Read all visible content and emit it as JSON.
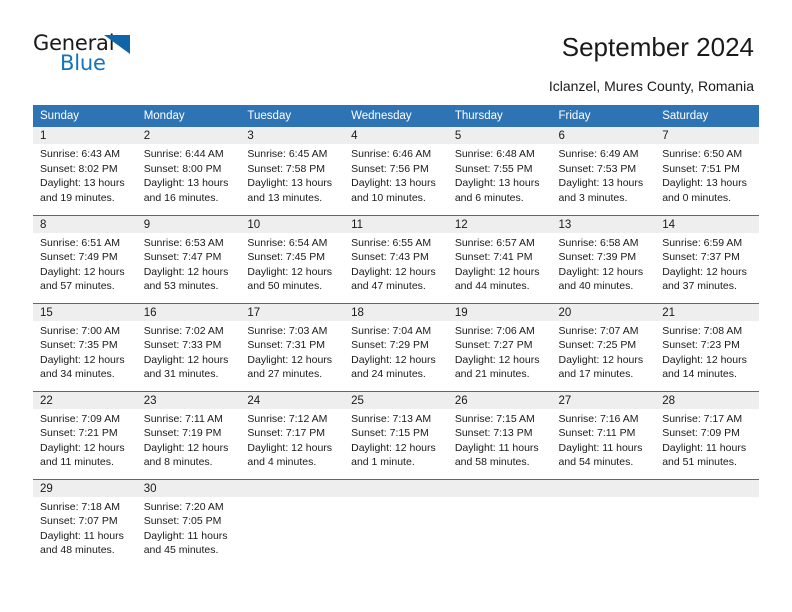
{
  "brand": {
    "word1": "General",
    "word2": "Blue",
    "triangle_color": "#1064a8",
    "blue_text_color": "#1274bd"
  },
  "header": {
    "title": "September 2024",
    "subtitle": "Iclanzel, Mures County, Romania"
  },
  "theme": {
    "header_row_bg": "#2e74b5",
    "header_row_text": "#ffffff",
    "daynum_bg": "#eeeeee",
    "cell_bg": "#ffffff",
    "grid_line": "#2e74b5"
  },
  "columns": [
    "Sunday",
    "Monday",
    "Tuesday",
    "Wednesday",
    "Thursday",
    "Friday",
    "Saturday"
  ],
  "labels": {
    "sunrise_prefix": "Sunrise:",
    "sunset_prefix": "Sunset:",
    "daylight_prefix": "Daylight:"
  },
  "weeks": [
    [
      {
        "day": "1",
        "sunrise": "Sunrise: 6:43 AM",
        "sunset": "Sunset: 8:02 PM",
        "daylight1": "Daylight: 13 hours",
        "daylight2": "and 19 minutes."
      },
      {
        "day": "2",
        "sunrise": "Sunrise: 6:44 AM",
        "sunset": "Sunset: 8:00 PM",
        "daylight1": "Daylight: 13 hours",
        "daylight2": "and 16 minutes."
      },
      {
        "day": "3",
        "sunrise": "Sunrise: 6:45 AM",
        "sunset": "Sunset: 7:58 PM",
        "daylight1": "Daylight: 13 hours",
        "daylight2": "and 13 minutes."
      },
      {
        "day": "4",
        "sunrise": "Sunrise: 6:46 AM",
        "sunset": "Sunset: 7:56 PM",
        "daylight1": "Daylight: 13 hours",
        "daylight2": "and 10 minutes."
      },
      {
        "day": "5",
        "sunrise": "Sunrise: 6:48 AM",
        "sunset": "Sunset: 7:55 PM",
        "daylight1": "Daylight: 13 hours",
        "daylight2": "and 6 minutes."
      },
      {
        "day": "6",
        "sunrise": "Sunrise: 6:49 AM",
        "sunset": "Sunset: 7:53 PM",
        "daylight1": "Daylight: 13 hours",
        "daylight2": "and 3 minutes."
      },
      {
        "day": "7",
        "sunrise": "Sunrise: 6:50 AM",
        "sunset": "Sunset: 7:51 PM",
        "daylight1": "Daylight: 13 hours",
        "daylight2": "and 0 minutes."
      }
    ],
    [
      {
        "day": "8",
        "sunrise": "Sunrise: 6:51 AM",
        "sunset": "Sunset: 7:49 PM",
        "daylight1": "Daylight: 12 hours",
        "daylight2": "and 57 minutes."
      },
      {
        "day": "9",
        "sunrise": "Sunrise: 6:53 AM",
        "sunset": "Sunset: 7:47 PM",
        "daylight1": "Daylight: 12 hours",
        "daylight2": "and 53 minutes."
      },
      {
        "day": "10",
        "sunrise": "Sunrise: 6:54 AM",
        "sunset": "Sunset: 7:45 PM",
        "daylight1": "Daylight: 12 hours",
        "daylight2": "and 50 minutes."
      },
      {
        "day": "11",
        "sunrise": "Sunrise: 6:55 AM",
        "sunset": "Sunset: 7:43 PM",
        "daylight1": "Daylight: 12 hours",
        "daylight2": "and 47 minutes."
      },
      {
        "day": "12",
        "sunrise": "Sunrise: 6:57 AM",
        "sunset": "Sunset: 7:41 PM",
        "daylight1": "Daylight: 12 hours",
        "daylight2": "and 44 minutes."
      },
      {
        "day": "13",
        "sunrise": "Sunrise: 6:58 AM",
        "sunset": "Sunset: 7:39 PM",
        "daylight1": "Daylight: 12 hours",
        "daylight2": "and 40 minutes."
      },
      {
        "day": "14",
        "sunrise": "Sunrise: 6:59 AM",
        "sunset": "Sunset: 7:37 PM",
        "daylight1": "Daylight: 12 hours",
        "daylight2": "and 37 minutes."
      }
    ],
    [
      {
        "day": "15",
        "sunrise": "Sunrise: 7:00 AM",
        "sunset": "Sunset: 7:35 PM",
        "daylight1": "Daylight: 12 hours",
        "daylight2": "and 34 minutes."
      },
      {
        "day": "16",
        "sunrise": "Sunrise: 7:02 AM",
        "sunset": "Sunset: 7:33 PM",
        "daylight1": "Daylight: 12 hours",
        "daylight2": "and 31 minutes."
      },
      {
        "day": "17",
        "sunrise": "Sunrise: 7:03 AM",
        "sunset": "Sunset: 7:31 PM",
        "daylight1": "Daylight: 12 hours",
        "daylight2": "and 27 minutes."
      },
      {
        "day": "18",
        "sunrise": "Sunrise: 7:04 AM",
        "sunset": "Sunset: 7:29 PM",
        "daylight1": "Daylight: 12 hours",
        "daylight2": "and 24 minutes."
      },
      {
        "day": "19",
        "sunrise": "Sunrise: 7:06 AM",
        "sunset": "Sunset: 7:27 PM",
        "daylight1": "Daylight: 12 hours",
        "daylight2": "and 21 minutes."
      },
      {
        "day": "20",
        "sunrise": "Sunrise: 7:07 AM",
        "sunset": "Sunset: 7:25 PM",
        "daylight1": "Daylight: 12 hours",
        "daylight2": "and 17 minutes."
      },
      {
        "day": "21",
        "sunrise": "Sunrise: 7:08 AM",
        "sunset": "Sunset: 7:23 PM",
        "daylight1": "Daylight: 12 hours",
        "daylight2": "and 14 minutes."
      }
    ],
    [
      {
        "day": "22",
        "sunrise": "Sunrise: 7:09 AM",
        "sunset": "Sunset: 7:21 PM",
        "daylight1": "Daylight: 12 hours",
        "daylight2": "and 11 minutes."
      },
      {
        "day": "23",
        "sunrise": "Sunrise: 7:11 AM",
        "sunset": "Sunset: 7:19 PM",
        "daylight1": "Daylight: 12 hours",
        "daylight2": "and 8 minutes."
      },
      {
        "day": "24",
        "sunrise": "Sunrise: 7:12 AM",
        "sunset": "Sunset: 7:17 PM",
        "daylight1": "Daylight: 12 hours",
        "daylight2": "and 4 minutes."
      },
      {
        "day": "25",
        "sunrise": "Sunrise: 7:13 AM",
        "sunset": "Sunset: 7:15 PM",
        "daylight1": "Daylight: 12 hours",
        "daylight2": "and 1 minute."
      },
      {
        "day": "26",
        "sunrise": "Sunrise: 7:15 AM",
        "sunset": "Sunset: 7:13 PM",
        "daylight1": "Daylight: 11 hours",
        "daylight2": "and 58 minutes."
      },
      {
        "day": "27",
        "sunrise": "Sunrise: 7:16 AM",
        "sunset": "Sunset: 7:11 PM",
        "daylight1": "Daylight: 11 hours",
        "daylight2": "and 54 minutes."
      },
      {
        "day": "28",
        "sunrise": "Sunrise: 7:17 AM",
        "sunset": "Sunset: 7:09 PM",
        "daylight1": "Daylight: 11 hours",
        "daylight2": "and 51 minutes."
      }
    ],
    [
      {
        "day": "29",
        "sunrise": "Sunrise: 7:18 AM",
        "sunset": "Sunset: 7:07 PM",
        "daylight1": "Daylight: 11 hours",
        "daylight2": "and 48 minutes."
      },
      {
        "day": "30",
        "sunrise": "Sunrise: 7:20 AM",
        "sunset": "Sunset: 7:05 PM",
        "daylight1": "Daylight: 11 hours",
        "daylight2": "and 45 minutes."
      },
      {
        "day": "",
        "sunrise": "",
        "sunset": "",
        "daylight1": "",
        "daylight2": ""
      },
      {
        "day": "",
        "sunrise": "",
        "sunset": "",
        "daylight1": "",
        "daylight2": ""
      },
      {
        "day": "",
        "sunrise": "",
        "sunset": "",
        "daylight1": "",
        "daylight2": ""
      },
      {
        "day": "",
        "sunrise": "",
        "sunset": "",
        "daylight1": "",
        "daylight2": ""
      },
      {
        "day": "",
        "sunrise": "",
        "sunset": "",
        "daylight1": "",
        "daylight2": ""
      }
    ]
  ]
}
